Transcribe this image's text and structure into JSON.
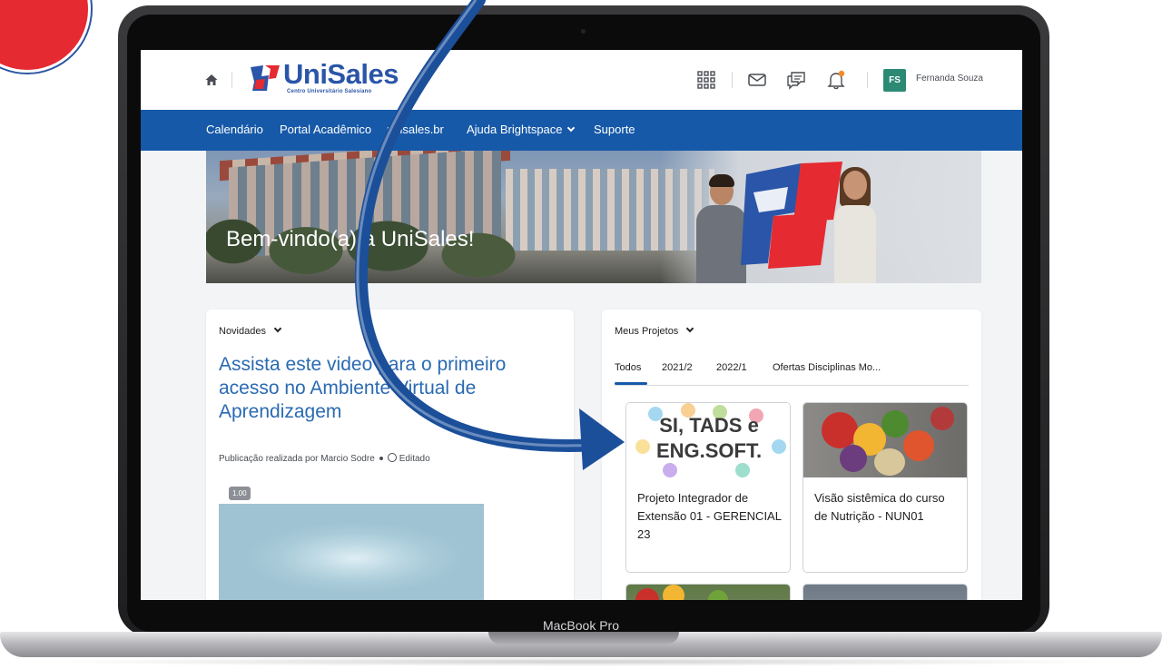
{
  "device": {
    "model": "MacBook Pro"
  },
  "topbar": {
    "logo_text": "UniSales",
    "logo_sub": "Centro Universitário Salesiano",
    "user_initials": "FS",
    "user_name": "Fernanda Souza"
  },
  "nav": {
    "items": [
      {
        "label": "Calendário"
      },
      {
        "label": "Portal Acadêmico"
      },
      {
        "label": "unisales.br"
      },
      {
        "label": "Ajuda Brightspace"
      },
      {
        "label": "Suporte"
      }
    ]
  },
  "banner": {
    "title": "Bem-vindo(a) à UniSales!"
  },
  "news": {
    "header": "Novidades",
    "title": "Assista este video para o primeiro acesso no Ambiente Virtual de Aprendizagem",
    "meta_author": "Publicação realizada por Marcio Sodre",
    "meta_status": "Editado",
    "zoom": "1.00"
  },
  "projects": {
    "header": "Meus Projetos",
    "tabs": [
      {
        "label": "Todos",
        "active": true
      },
      {
        "label": "2021/2"
      },
      {
        "label": "2022/1"
      },
      {
        "label": "Ofertas Disciplinas Mo..."
      }
    ],
    "courses": [
      {
        "title": "Projeto Integrador de Extensão 01 - GERENCIAL 23",
        "image_text_1": "SI, TADS e",
        "image_text_2": "ENG.SOFT."
      },
      {
        "title": "Visão sistêmica do curso de Nutrição - NUN01"
      },
      {
        "title": ""
      },
      {
        "title": ""
      }
    ]
  },
  "colors": {
    "nav_blue": "#1659a8",
    "link_blue": "#2a6ab2",
    "logo_blue": "#2a55a8",
    "logo_red": "#e52a31",
    "avatar_green": "#2c8a74",
    "arrow_blue": "#1b4f9a",
    "notification_dot": "#f28c28"
  },
  "icons": {
    "home": "home-icon",
    "apps": "grid-icon",
    "mail": "mail-icon",
    "chat": "chat-icon",
    "bell": "bell-icon",
    "edit": "history-icon"
  }
}
